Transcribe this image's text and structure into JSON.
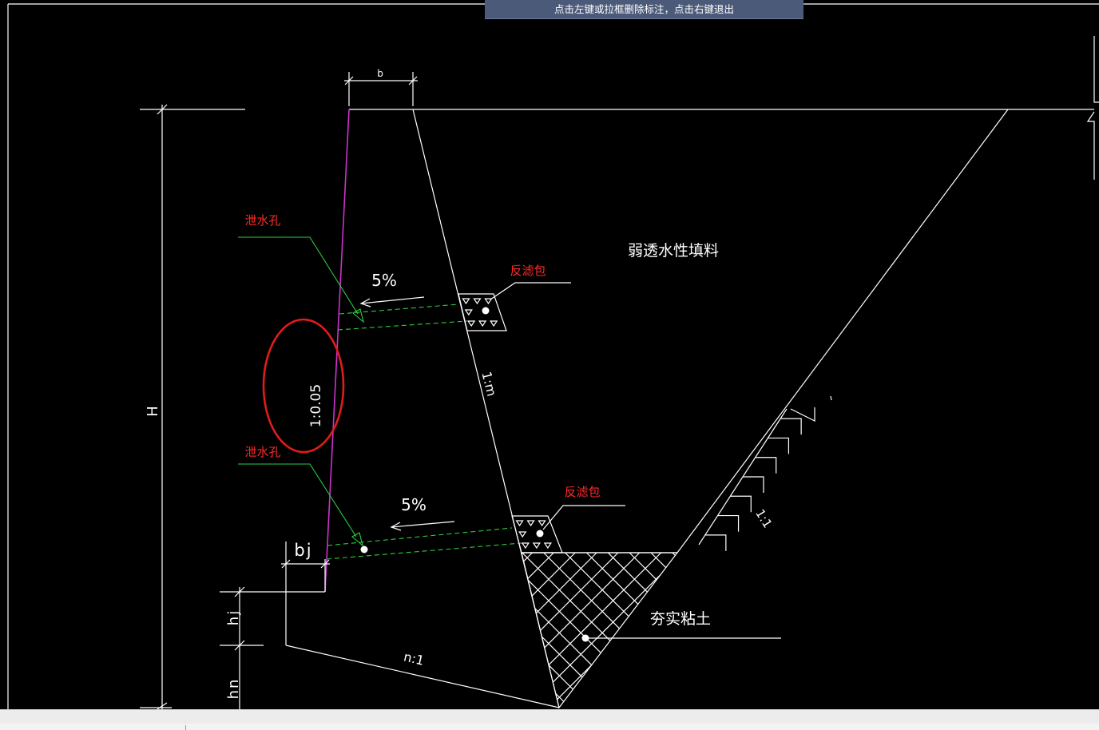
{
  "window": {
    "prompt_banner": "点击左键或拉框删除标注，点击右键退出"
  },
  "drawing": {
    "dimensions": {
      "b": "b",
      "H": "H",
      "bj": "bj",
      "hj": "hj",
      "hn": "hn"
    },
    "slopes": {
      "wall_front": "1:0.05",
      "wall_back": "1:m",
      "base": "n:1",
      "excavation": "1:1"
    },
    "materials": {
      "backfill": "弱透水性填料",
      "compacted_clay": "夯实粘土"
    },
    "drain_holes": [
      {
        "label": "泄水孔",
        "gradient": "5%",
        "filter_label": "反滤包"
      },
      {
        "label": "泄水孔",
        "gradient": "5%",
        "filter_label": "反滤包"
      }
    ]
  },
  "colors": {
    "canvas_background": "#000000",
    "line": "#ffffff",
    "wall_front_face": "#cc33cc",
    "drain_pipe": "#2ecc40",
    "annotation_text": "#ff2a2a",
    "highlight_ellipse": "#e21b1b",
    "banner_background": "#4b5a79",
    "status_bar": "#ececec"
  }
}
